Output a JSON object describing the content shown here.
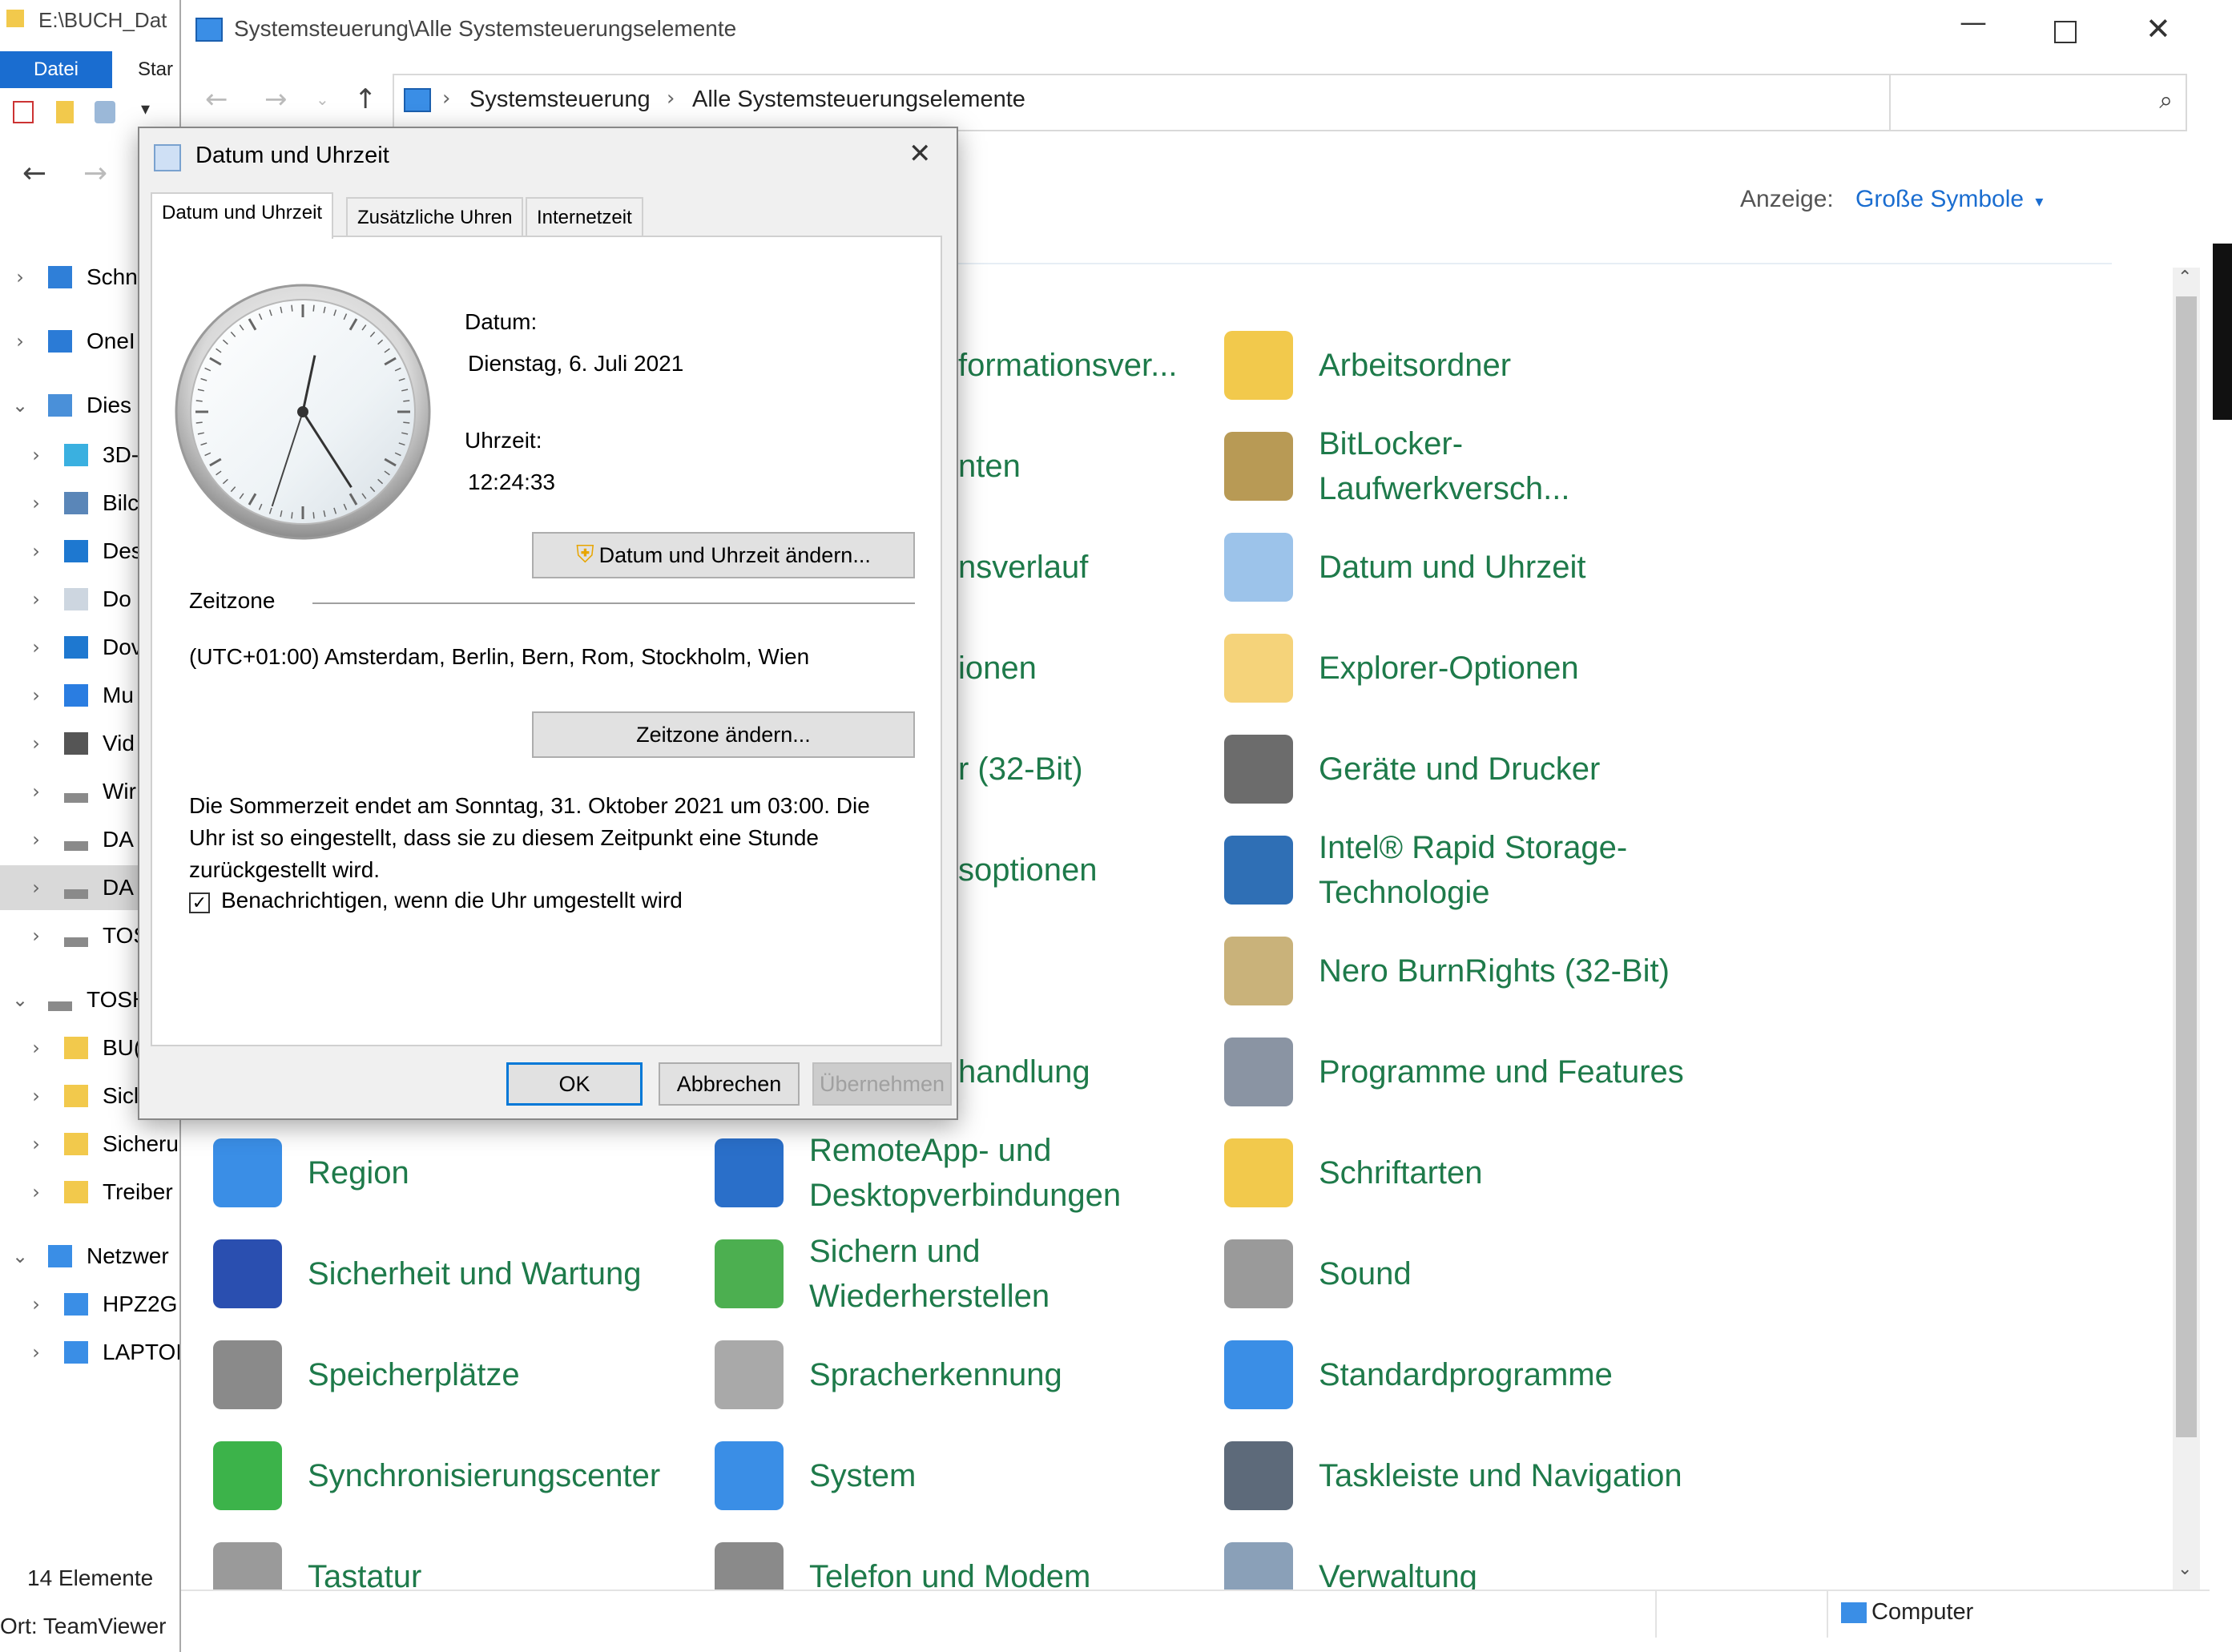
{
  "background_explorer": {
    "title": "E:\\BUCH_Dat",
    "ribbon": {
      "file": "Datei",
      "start": "Star"
    },
    "tree": [
      {
        "label": "Schn",
        "icon": "star-icon",
        "expanded": false
      },
      {
        "label": "OneI",
        "icon": "cloud-icon",
        "expanded": false
      },
      {
        "label": "Dies",
        "icon": "pc-icon",
        "expanded": true
      },
      {
        "label": "3D-",
        "icon": "cube-icon",
        "expanded": false
      },
      {
        "label": "Bilc",
        "icon": "pictures-icon",
        "expanded": false
      },
      {
        "label": "Des",
        "icon": "desktop-icon",
        "expanded": false
      },
      {
        "label": "Do",
        "icon": "document-icon",
        "expanded": false
      },
      {
        "label": "Dov",
        "icon": "download-icon",
        "expanded": false
      },
      {
        "label": "Mu",
        "icon": "music-icon",
        "expanded": false
      },
      {
        "label": "Vid",
        "icon": "video-icon",
        "expanded": false
      },
      {
        "label": "Wir",
        "icon": "drive-icon",
        "expanded": false
      },
      {
        "label": "DA",
        "icon": "drive-icon",
        "expanded": false
      },
      {
        "label": "DA",
        "icon": "drive-icon",
        "expanded": false
      },
      {
        "label": "TOS",
        "icon": "drive-icon",
        "expanded": false
      },
      {
        "label": "TOSH",
        "icon": "drive-icon",
        "expanded": true
      },
      {
        "label": "BU(",
        "icon": "folder-icon",
        "expanded": false
      },
      {
        "label": "Sicl",
        "icon": "folder-icon",
        "expanded": false
      },
      {
        "label": "Sicheru",
        "icon": "folder-icon",
        "expanded": false
      },
      {
        "label": "Treiber",
        "icon": "folder-icon",
        "expanded": false
      },
      {
        "label": "Netzwer",
        "icon": "network-icon",
        "expanded": true
      },
      {
        "label": "HPZ2G",
        "icon": "computer-icon",
        "expanded": false
      },
      {
        "label": "LAPTOI",
        "icon": "computer-icon",
        "expanded": false
      }
    ],
    "status": "14 Elemente",
    "location": "Ort: TeamViewer"
  },
  "control_panel": {
    "title": "Systemsteuerung\\Alle Systemsteuerungselemente",
    "breadcrumb": [
      "Systemsteuerung",
      "Alle Systemsteuerungselemente"
    ],
    "view_label": "Anzeige:",
    "view_value": "Große Symbole",
    "status_right": "Computer",
    "items_col2_partial": [
      "formationsver...",
      "nten",
      "nsverlauf",
      "ionen",
      "r (32-Bit)",
      "soptionen",
      "handlung"
    ],
    "items_col3": [
      "Arbeitsordner",
      "BitLocker-Laufwerkversch...",
      "Datum und Uhrzeit",
      "Explorer-Optionen",
      "Geräte und Drucker",
      "Intel® Rapid Storage-Technologie",
      "Nero BurnRights (32-Bit)",
      "Programme und Features",
      "Schriftarten",
      "Sound",
      "Standardprogramme",
      "Taskleiste und Navigation",
      "Verwaltung"
    ],
    "items_col1": [
      "Region",
      "Sicherheit und Wartung",
      "Speicherplätze",
      "Synchronisierungscenter",
      "Tastatur"
    ],
    "items_col2": [
      "RemoteApp- und Desktopverbindungen",
      "Sichern und Wiederherstellen",
      "Spracherkennung",
      "System",
      "Telefon und Modem"
    ]
  },
  "dialog": {
    "title": "Datum und Uhrzeit",
    "tabs": [
      "Datum und Uhrzeit",
      "Zusätzliche Uhren",
      "Internetzeit"
    ],
    "date_label": "Datum:",
    "date_value": "Dienstag, 6. Juli 2021",
    "time_label": "Uhrzeit:",
    "time_value": "12:24:33",
    "change_datetime_button": "Datum und Uhrzeit ändern...",
    "timezone_header": "Zeitzone",
    "timezone_value": "(UTC+01:00) Amsterdam, Berlin, Bern, Rom, Stockholm, Wien",
    "change_timezone_button": "Zeitzone ändern...",
    "dst_info": "Die Sommerzeit endet am Sonntag, 31. Oktober 2021 um 03:00. Die Uhr ist so eingestellt, dass sie zu diesem Zeitpunkt eine Stunde zurückgestellt wird.",
    "notify_checkbox": "Benachrichtigen, wenn die Uhr umgestellt wird",
    "notify_checked": true,
    "ok_button": "OK",
    "cancel_button": "Abbrechen",
    "apply_button": "Übernehmen",
    "clock": {
      "hours": 12,
      "minutes": 24,
      "seconds": 33
    }
  },
  "colors": {
    "accent": "#0078d7",
    "link_green": "#1e7a4a",
    "file_tab": "#1a6dd0"
  }
}
